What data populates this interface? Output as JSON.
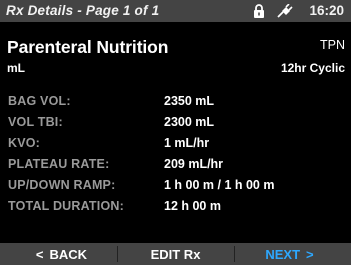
{
  "statusbar": {
    "title": "Rx Details - Page 1 of 1",
    "time": "16:20",
    "icons": [
      "lock-icon",
      "plug-icon"
    ]
  },
  "header": {
    "title": "Parenteral Nutrition",
    "type": "TPN",
    "unit": "mL",
    "mode": "12hr Cyclic"
  },
  "details": [
    {
      "label": "BAG VOL:",
      "value": "2350 mL"
    },
    {
      "label": "VOL TBI:",
      "value": "2300 mL"
    },
    {
      "label": "KVO:",
      "value": "1 mL/hr"
    },
    {
      "label": "PLATEAU RATE:",
      "value": "209 mL/hr"
    },
    {
      "label": "UP/DOWN RAMP:",
      "value": "1 h 00 m / 1 h 00 m"
    },
    {
      "label": "TOTAL DURATION:",
      "value": "12 h 00 m"
    }
  ],
  "footer": {
    "back_label": "BACK",
    "edit_label": "EDIT Rx",
    "next_label": "NEXT",
    "back_icon": "chevron-left-icon",
    "next_icon": "chevron-right-icon",
    "next_color": "#2da8ff"
  },
  "colors": {
    "statusbar_bg": "#444444",
    "label_gray": "#9a9a9a",
    "accent_blue": "#2da8ff"
  }
}
